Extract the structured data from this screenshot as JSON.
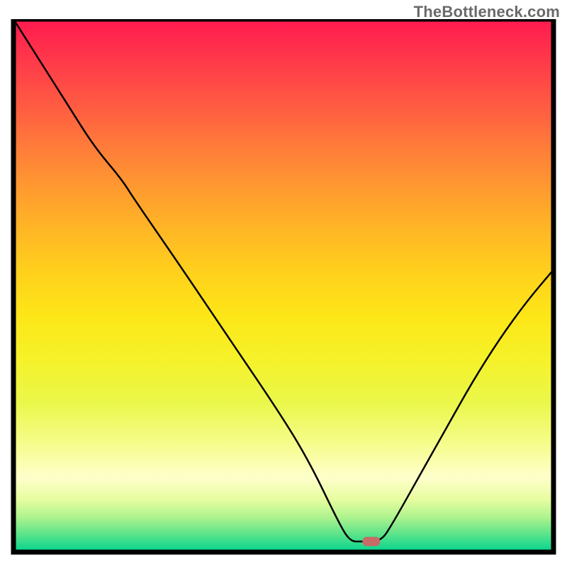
{
  "watermark": "TheBottleneck.com",
  "chart_data": {
    "type": "line",
    "title": "",
    "xlabel": "",
    "ylabel": "",
    "x": [
      0.0,
      0.05,
      0.1,
      0.15,
      0.2,
      0.225,
      0.3,
      0.4,
      0.5,
      0.55,
      0.6,
      0.6225,
      0.645,
      0.68,
      0.7,
      0.75,
      0.8,
      0.85,
      0.9,
      0.95,
      1.0
    ],
    "values": [
      1.0,
      0.92,
      0.84,
      0.76,
      0.7,
      0.66,
      0.55,
      0.4,
      0.25,
      0.165,
      0.06,
      0.02,
      0.02,
      0.02,
      0.05,
      0.14,
      0.23,
      0.32,
      0.4,
      0.47,
      0.53
    ],
    "xlim": [
      0,
      1
    ],
    "ylim": [
      0,
      1
    ],
    "grid": false,
    "legend": false,
    "marker": {
      "x": 0.6625,
      "y": 0.02,
      "color": "#c76b66",
      "shape": "rounded-rect"
    },
    "background_gradient_colors": [
      "#ff1a50",
      "#ff3a4a",
      "#ff5a42",
      "#ff7c3a",
      "#ff9b2f",
      "#ffb825",
      "#ffd21c",
      "#fde718",
      "#f5f22a",
      "#eaf74a",
      "#f7fd8f",
      "#fefecb",
      "#e8fda0",
      "#adf38e",
      "#5fe48a",
      "#00d490"
    ],
    "annotations": []
  }
}
